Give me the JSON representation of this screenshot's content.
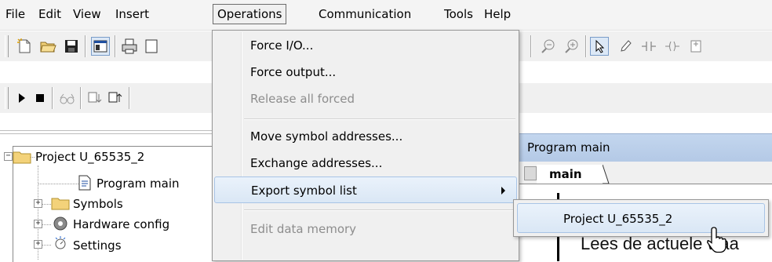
{
  "menubar": {
    "items": [
      {
        "label": "File"
      },
      {
        "label": "Edit"
      },
      {
        "label": "View"
      },
      {
        "label": "Insert"
      },
      {
        "label": "Operations"
      },
      {
        "label": "Communication"
      },
      {
        "label": "Tools"
      },
      {
        "label": "Help"
      }
    ]
  },
  "operations_menu": {
    "items": [
      {
        "label": "Force I/O...",
        "enabled": true
      },
      {
        "label": "Force output...",
        "enabled": true
      },
      {
        "label": "Release all forced",
        "enabled": false
      },
      {
        "label": "Move symbol addresses...",
        "enabled": true
      },
      {
        "label": "Exchange addresses...",
        "enabled": true
      },
      {
        "label": "Export symbol list",
        "enabled": true,
        "has_submenu": true,
        "highlighted": true
      },
      {
        "label": "Edit data memory",
        "enabled": false
      }
    ]
  },
  "submenu": {
    "items": [
      {
        "label": "Project U_65535_2",
        "highlighted": true
      }
    ]
  },
  "tree": {
    "project": "Project U_65535_2",
    "children": [
      {
        "label": "Program main",
        "icon": "program-icon"
      },
      {
        "label": "Symbols",
        "icon": "folder-icon"
      },
      {
        "label": "Hardware config",
        "icon": "hardware-icon"
      },
      {
        "label": "Settings",
        "icon": "settings-icon"
      }
    ]
  },
  "program_window": {
    "title": "Program main",
    "tab": "main",
    "content_text": "Lees de actuele waa"
  },
  "colors": {
    "menu_bg": "#f0f0f0",
    "highlight": "#dae7f5",
    "title_bar": "#b9cde8",
    "folder": "#f3d27a"
  }
}
